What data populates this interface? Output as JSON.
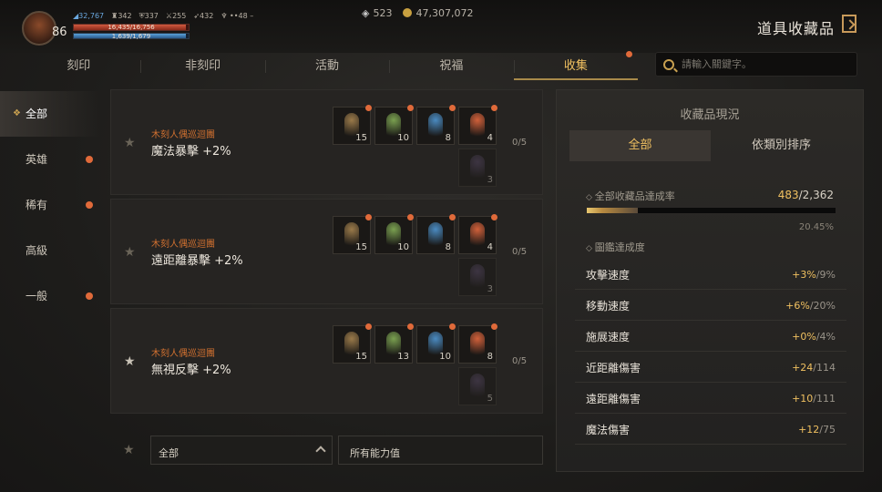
{
  "player": {
    "level": "86",
    "stats": [
      "32,767",
      "342",
      "337",
      "255",
      "432",
      "48"
    ],
    "hp": "16,435/16,756",
    "mp": "1,639/1,679",
    "hp_fraction": 0.98,
    "mp_fraction": 0.98
  },
  "currency": {
    "gems": "523",
    "gold": "47,307,072"
  },
  "page_title": "道具收藏品",
  "tabs": [
    "刻印",
    "非刻印",
    "活動",
    "祝福",
    "收集"
  ],
  "active_tab": 4,
  "search": {
    "placeholder": "請輸入關鍵字。"
  },
  "sidebar": [
    "全部",
    "英雄",
    "稀有",
    "高級",
    "一般"
  ],
  "cards": [
    {
      "source": "木刻人偶巡迴團",
      "name": "魔法暴擊 +2%",
      "progress": "0/5",
      "counts": [
        "15",
        "10",
        "8",
        "4",
        "3"
      ]
    },
    {
      "source": "木刻人偶巡迴團",
      "name": "遠距離暴擊 +2%",
      "progress": "0/5",
      "counts": [
        "15",
        "10",
        "8",
        "4",
        "3"
      ]
    },
    {
      "source": "木刻人偶巡迴團",
      "name": "無視反擊 +2%",
      "progress": "0/5",
      "counts": [
        "15",
        "13",
        "10",
        "8",
        "5"
      ]
    }
  ],
  "filter": {
    "grade": "全部",
    "ability": "所有能力值"
  },
  "panel": {
    "title": "收藏品現況",
    "tabs": [
      "全部",
      "依類別排序"
    ],
    "achievement_label": "全部收藏品達成率",
    "achievement_current": "483",
    "achievement_total": "/2,362",
    "achievement_pct": "20.45%",
    "achievement_fraction": 0.2045,
    "codex_label": "圖鑑達成度",
    "stats": [
      {
        "label": "攻擊速度",
        "cur": "+3%",
        "max": "/9%"
      },
      {
        "label": "移動速度",
        "cur": "+6%",
        "max": "/20%"
      },
      {
        "label": "施展速度",
        "cur": "+0%",
        "max": "/4%"
      },
      {
        "label": "近距離傷害",
        "cur": "+24",
        "max": "/114"
      },
      {
        "label": "遠距離傷害",
        "cur": "+10",
        "max": "/111"
      },
      {
        "label": "魔法傷害",
        "cur": "+12",
        "max": "/75"
      }
    ]
  },
  "colors": {
    "accent": "#f0c060",
    "notify": "#e06a3a",
    "source": "#d07030"
  }
}
